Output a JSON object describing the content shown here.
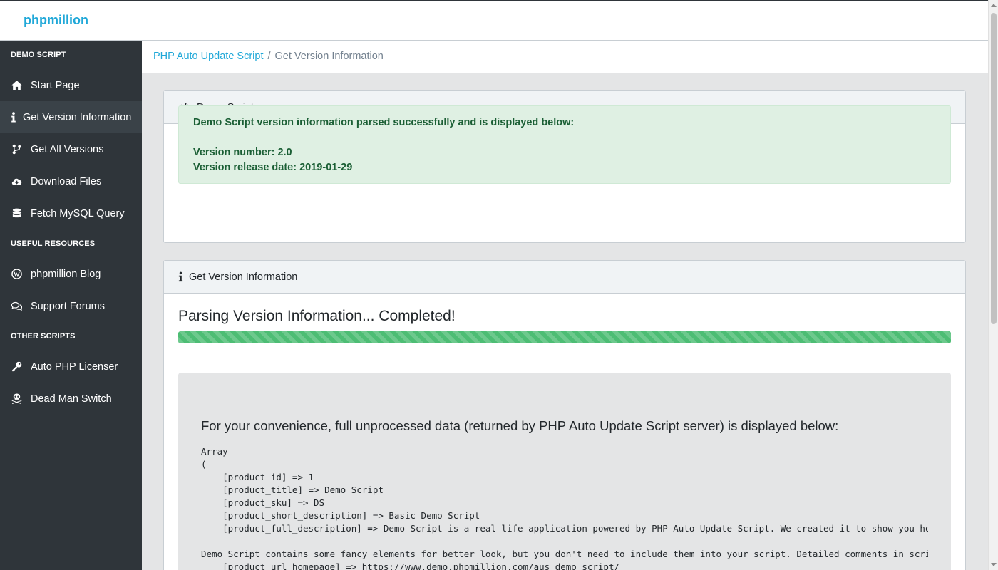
{
  "navbar": {
    "brand": "phpmillion"
  },
  "sidebar": {
    "sections": [
      {
        "title": "DEMO SCRIPT"
      },
      {
        "title": "USEFUL RESOURCES"
      },
      {
        "title": "OTHER SCRIPTS"
      }
    ],
    "items": [
      {
        "label": "Start Page",
        "icon": "home-icon"
      },
      {
        "label": "Get Version Information",
        "icon": "info-icon"
      },
      {
        "label": "Get All Versions",
        "icon": "code-branch-icon"
      },
      {
        "label": "Download Files",
        "icon": "cloud-download-icon"
      },
      {
        "label": "Fetch MySQL Query",
        "icon": "database-icon"
      },
      {
        "label": "phpmillion Blog",
        "icon": "wordpress-icon"
      },
      {
        "label": "Support Forums",
        "icon": "comments-icon"
      },
      {
        "label": "Auto PHP Licenser",
        "icon": "key-icon"
      },
      {
        "label": "Dead Man Switch",
        "icon": "skull-crossbones-icon"
      }
    ]
  },
  "breadcrumb": {
    "parent": "PHP Auto Update Script",
    "separator": "/",
    "current": "Get Version Information"
  },
  "card1": {
    "header": "Demo Script",
    "alert_title": "Demo Script version information parsed successfully and is displayed below:",
    "version_number": "Version number: 2.0",
    "release_date": "Version release date: 2019-01-29"
  },
  "card2": {
    "header": "Get Version Information",
    "progress_title": "Parsing Version Information... Completed!",
    "progress_percent": 100,
    "raw_title": "For your convenience, full unprocessed data (returned by PHP Auto Update Script server) is displayed below:",
    "raw_data": "Array\n(\n    [product_id] => 1\n    [product_title] => Demo Script\n    [product_sku] => DS\n    [product_short_description] => Basic Demo Script\n    [product_full_description] => Demo Script is a real-life application powered by PHP Auto Update Script. We created it to show you how e\n\nDemo Script contains some fancy elements for better look, but you don't need to include them into your script. Detailed comments in script'\n    [product_url_homepage] => https://www.demo.phpmillion.com/aus_demo_script/"
  },
  "colors": {
    "accent": "#20a8d8",
    "sidebar_bg": "#2f353a",
    "success": "#4dbd74",
    "alert_bg": "#dff0e3",
    "alert_text": "#1b5f35"
  }
}
